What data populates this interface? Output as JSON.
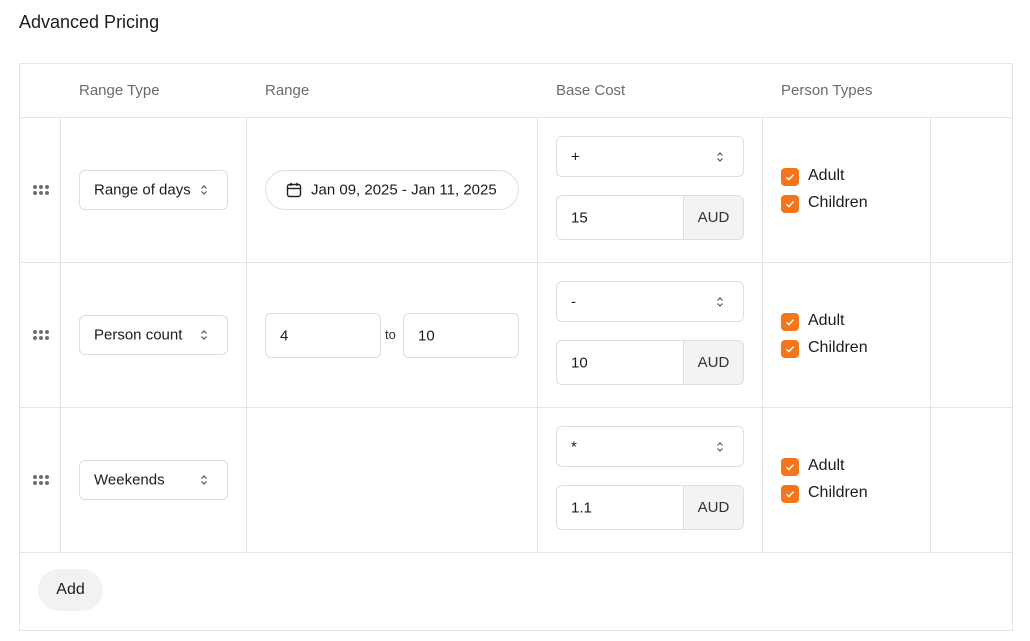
{
  "page": {
    "title": "Advanced Pricing"
  },
  "table": {
    "headers": {
      "range_type": "Range Type",
      "range": "Range",
      "base_cost": "Base Cost",
      "person_types": "Person Types"
    },
    "rows": [
      {
        "range_type": "Range of days",
        "date_range": "Jan 09, 2025 - Jan 11, 2025",
        "operator": "+",
        "cost": "15",
        "currency": "AUD",
        "persons": [
          {
            "label": "Adult",
            "checked": true
          },
          {
            "label": "Children",
            "checked": true
          }
        ]
      },
      {
        "range_type": "Person count",
        "from": "4",
        "to_label": "to",
        "to": "10",
        "operator": "-",
        "cost": "10",
        "currency": "AUD",
        "persons": [
          {
            "label": "Adult",
            "checked": true
          },
          {
            "label": "Children",
            "checked": true
          }
        ]
      },
      {
        "range_type": "Weekends",
        "operator": "*",
        "cost": "1.1",
        "currency": "AUD",
        "persons": [
          {
            "label": "Adult",
            "checked": true
          },
          {
            "label": "Children",
            "checked": true
          }
        ]
      }
    ],
    "add_label": "Add"
  },
  "colors": {
    "accent": "#f5761a",
    "border": "#e4e4e4",
    "header_text": "#6b6b6b"
  },
  "icons": {
    "drag": "drag-handle-icon",
    "calendar": "calendar-icon",
    "chevron": "chevron-up-down-icon",
    "check": "checkmark-icon"
  }
}
